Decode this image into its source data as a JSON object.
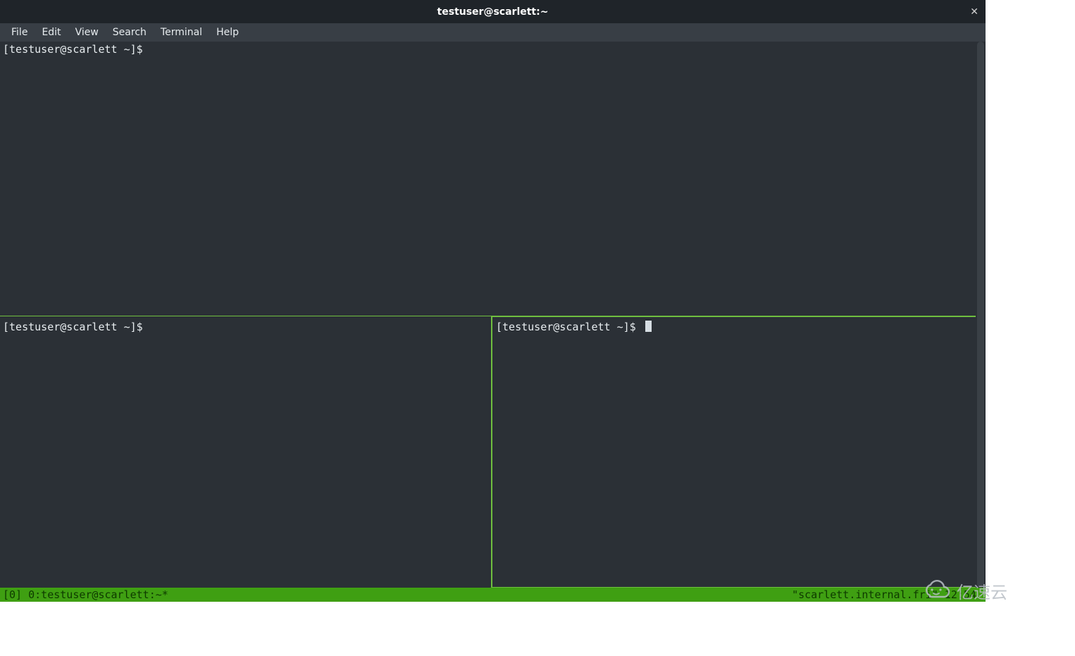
{
  "window": {
    "title": "testuser@scarlett:~"
  },
  "menu": {
    "items": [
      "File",
      "Edit",
      "View",
      "Search",
      "Terminal",
      "Help"
    ]
  },
  "panes": {
    "top": {
      "prompt": "[testuser@scarlett ~]$ "
    },
    "bl": {
      "prompt": "[testuser@scarlett ~]$ "
    },
    "br": {
      "prompt": "[testuser@scarlett ~]$ ",
      "active": true
    }
  },
  "status": {
    "left": "[0] 0:testuser@scarlett:~*",
    "right": "\"scarlett.internal.fri\" 12:54 "
  },
  "watermark": {
    "text": "亿速云"
  }
}
